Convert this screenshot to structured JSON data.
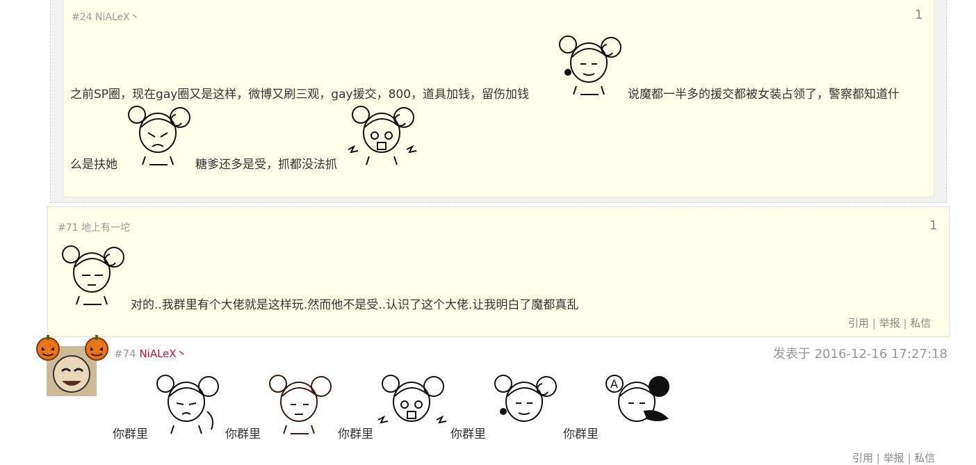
{
  "quote": {
    "floor": "#24",
    "author": "NiALeX丶",
    "count": "1",
    "line1": "之前SP圈，现在gay圈又是这样，微博又刷三观，gay援交，800，道具加钱，留伤加钱",
    "line1b": "说魔都一半多的援交都被女装占领了，警察都知道什",
    "line2a": "么是扶她",
    "line2b": "糖爹还多是受，抓都没法抓"
  },
  "reply71": {
    "floor": "#71",
    "author": "地上有一坨",
    "count": "1",
    "text": "对的..我群里有个大佬就是这样玩.然而他不是受..认识了这个大佬.让我明白了魔都真乱",
    "actions": [
      "引用",
      "举报",
      "私信"
    ]
  },
  "post74": {
    "floor": "#74",
    "author": "NiALeX丶",
    "date": "发表于 2016-12-16 17:27:18",
    "segments": [
      "你群里",
      "你群里",
      "你群里",
      "你群里",
      "你群里"
    ],
    "actions": [
      "引用",
      "举报",
      "私信"
    ]
  },
  "colors": {
    "quote_bg": "#fefee9",
    "author_red": "#c8102e",
    "meta_gray": "#999999"
  },
  "icons": [
    "gintama-emoji",
    "pumpkin-icon",
    "avatar"
  ]
}
